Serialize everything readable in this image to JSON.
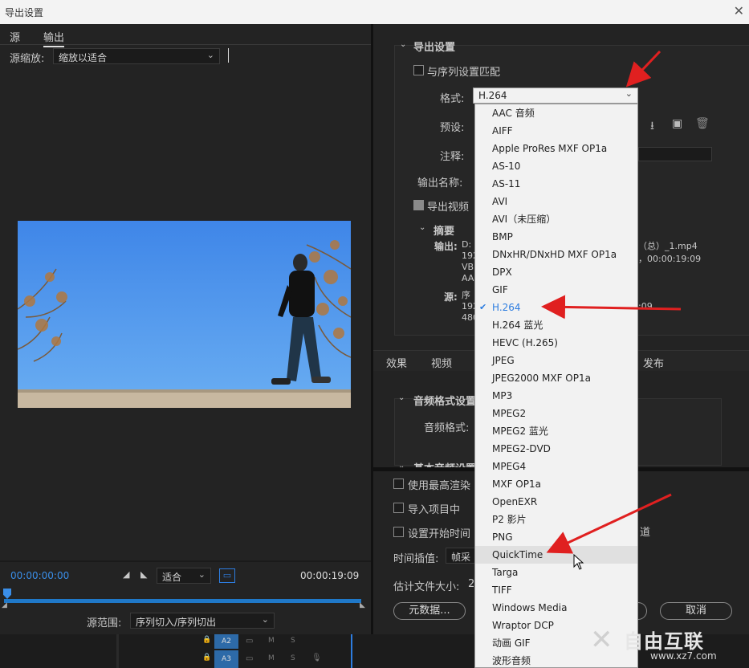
{
  "window": {
    "title": "导出设置",
    "close_label": "✕"
  },
  "left": {
    "tabs": [
      "源",
      "输出"
    ],
    "scale_label": "源缩放:",
    "scale_value": "缩放以适合",
    "timecode_start": "00:00:00:00",
    "timecode_end": "00:00:19:09",
    "fit_value": "适合",
    "range_label": "源范围:",
    "range_value": "序列切入/序列切出"
  },
  "export": {
    "header": "导出设置",
    "match_sequence": "与序列设置匹配",
    "format_label": "格式:",
    "format_value": "H.264",
    "preset_label": "预设:",
    "comments_label": "注释:",
    "output_name_label": "输出名称:",
    "export_video": "导出视频",
    "summary_header": "摘要",
    "output_label": "输出:",
    "output_lines": [
      "D:",
      "192",
      "VB",
      "AA"
    ],
    "output_right_1": "（总）_1.mp4",
    "output_right_2": "，00:00:19:09",
    "source_label": "源:",
    "source_lines": [
      "序",
      "192",
      "480"
    ],
    "source_right": ":09"
  },
  "lower_tabs": [
    "效果",
    "视频",
    "发布"
  ],
  "audio": {
    "section_header": "音频格式设置",
    "format_label": "音频格式:",
    "basic_header": "基本音频设置"
  },
  "bottom": {
    "max_render": "使用最高渲染",
    "import_project": "导入项目中",
    "set_start_time": "设置开始时间",
    "channel_suffix": "道",
    "interp_label": "时间插值:",
    "interp_value": "帧采",
    "filesize_label": "估计文件大小:",
    "filesize_value": "2",
    "metadata_button": "元数据...",
    "cancel_button": "取消"
  },
  "timeline": {
    "tracks": [
      "A2",
      "A3"
    ],
    "track_m": "M",
    "track_s": "S"
  },
  "dropdown": {
    "items": [
      "AAC 音频",
      "AIFF",
      "Apple ProRes MXF OP1a",
      "AS-10",
      "AS-11",
      "AVI",
      "AVI（未压缩）",
      "BMP",
      "DNxHR/DNxHD MXF OP1a",
      "DPX",
      "GIF",
      "H.264",
      "H.264 蓝光",
      "HEVC (H.265)",
      "JPEG",
      "JPEG2000 MXF OP1a",
      "MP3",
      "MPEG2",
      "MPEG2 蓝光",
      "MPEG2-DVD",
      "MPEG4",
      "MXF OP1a",
      "OpenEXR",
      "P2 影片",
      "PNG",
      "QuickTime",
      "Targa",
      "TIFF",
      "Windows Media",
      "Wraptor DCP",
      "动画 GIF",
      "波形音频"
    ],
    "selected": "H.264",
    "hovered": "QuickTime"
  },
  "watermark": {
    "brand": "自由互联",
    "site": "www.xz7.com"
  },
  "colors": {
    "accent_blue": "#2d7de0",
    "arrow_red": "#e02020",
    "timeline_blue": "#1f78c8"
  }
}
